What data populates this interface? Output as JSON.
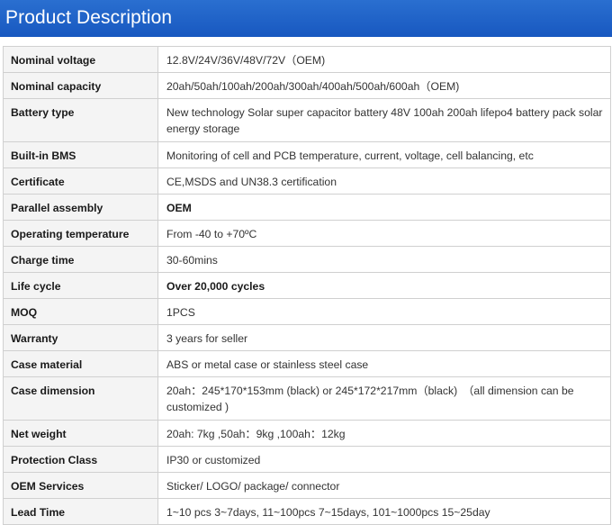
{
  "header": {
    "title": "Product Description",
    "background_color": "#1c64c8"
  },
  "specs": [
    {
      "label": "Nominal voltage",
      "value": "12.8V/24V/36V/48V/72V（OEM)",
      "bold": false
    },
    {
      "label": "Nominal capacity",
      "value": "20ah/50ah/100ah/200ah/300ah/400ah/500ah/600ah（OEM)",
      "bold": false
    },
    {
      "label": "Battery type",
      "value": "New technology Solar super capacitor battery 48V 100ah 200ah lifepo4 battery pack solar energy storage",
      "bold": false
    },
    {
      "label": "Built-in BMS",
      "value": "Monitoring of cell and PCB temperature, current, voltage, cell balancing, etc",
      "bold": false
    },
    {
      "label": "Certificate",
      "value": "CE,MSDS and UN38.3 certification",
      "bold": false
    },
    {
      "label": "Parallel assembly",
      "value": "OEM",
      "bold": true
    },
    {
      "label": "Operating temperature",
      "value": "From -40 to +70ºC",
      "bold": false
    },
    {
      "label": "Charge time",
      "value": "30-60mins",
      "bold": false
    },
    {
      "label": "Life cycle",
      "value": "Over 20,000 cycles",
      "bold": true
    },
    {
      "label": "MOQ",
      "value": "1PCS",
      "bold": false
    },
    {
      "label": "Warranty",
      "value": "3 years for seller",
      "bold": false
    },
    {
      "label": "Case material",
      "value": "ABS or metal case or stainless steel case",
      "bold": false
    },
    {
      "label": "Case dimension",
      "value": "20ah：245*170*153mm (black) or 245*172*217mm（black)　（all dimension can be customized )",
      "bold": false
    },
    {
      "label": "Net weight",
      "value": "20ah:   7kg ,50ah：9kg ,100ah：12kg",
      "bold": false
    },
    {
      "label": "Protection Class",
      "value": "IP30 or customized",
      "bold": false
    },
    {
      "label": "OEM Services",
      "value": "Sticker/ LOGO/ package/ connector",
      "bold": false
    },
    {
      "label": "Lead Time",
      "value": "1~10 pcs 3~7days, 11~100pcs 7~15days, 101~1000pcs 15~25day",
      "bold": false
    }
  ]
}
